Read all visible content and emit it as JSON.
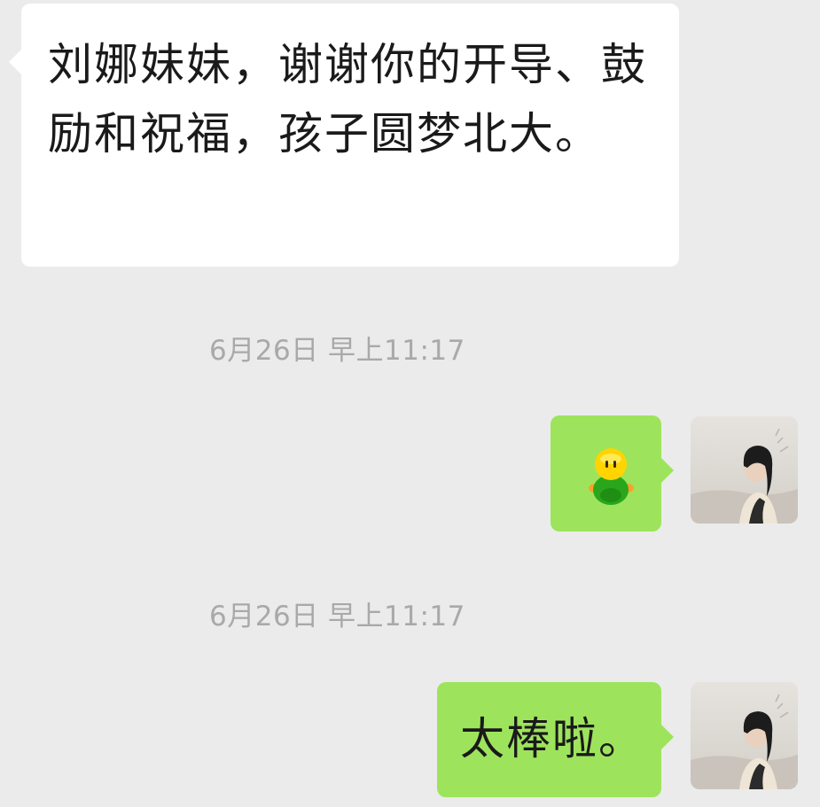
{
  "messages": {
    "received": {
      "text": "刘娜妹妹，谢谢你的开导、鼓励和祝福，孩子圆梦北大。"
    },
    "timestamp_1": "6月26日 早上11:17",
    "sent_1": {
      "content": "emoji",
      "icon": "green-smiley-emoji-icon"
    },
    "timestamp_2": "6月26日 早上11:17",
    "sent_2": {
      "text": "太棒啦。"
    }
  },
  "colors": {
    "background": "#ebebeb",
    "received_bubble": "#ffffff",
    "sent_bubble": "#9de45c",
    "timestamp": "#a9a9a9"
  }
}
